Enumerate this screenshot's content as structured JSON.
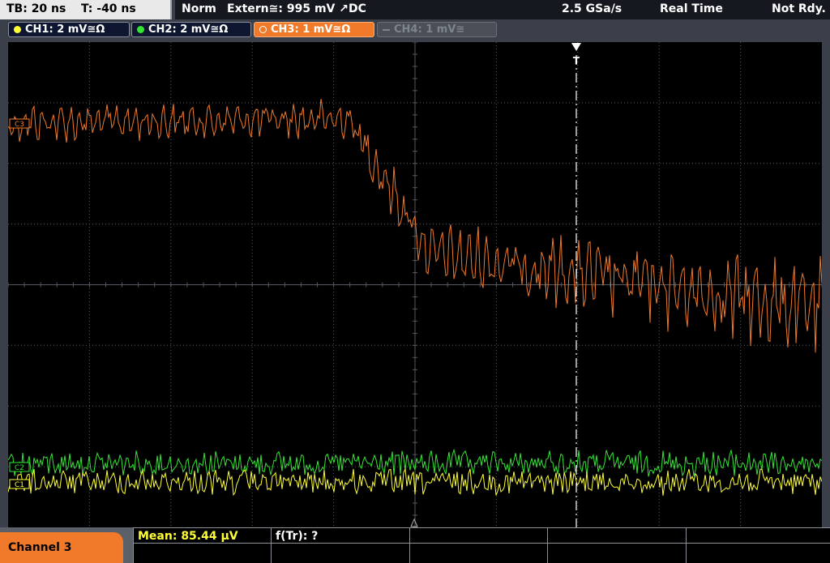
{
  "status": {
    "timebase": "TB: 20 ns",
    "trigger_time": "T: -40 ns",
    "trigger_mode": "Norm",
    "trigger_source": "Extern≅: 995 mV ↗DC",
    "sample_rate": "2.5 GSa/s",
    "acq_mode": "Real Time",
    "state": "Not Rdy."
  },
  "channels": [
    {
      "label": "CH1: 2 mV≅Ω",
      "color": "#ffff33",
      "active": false,
      "enabled": true
    },
    {
      "label": "CH2: 2 mV≅Ω",
      "color": "#33e633",
      "active": false,
      "enabled": true
    },
    {
      "label": "CH3: 1 mV≅Ω",
      "color": "#f07a2a",
      "active": true,
      "enabled": true
    },
    {
      "label": "CH4: 1 mV≅",
      "color": "#7f848c",
      "active": false,
      "enabled": false
    }
  ],
  "markers": {
    "ch3": "C3",
    "ch2": "C2",
    "ch1": "C1",
    "trigger": "T"
  },
  "bottom": {
    "channel_panel": "Channel 3",
    "mean": "Mean: 85.44 µV",
    "ftr": "f(Tr): ?"
  },
  "colors": {
    "ch1": "#ffff33",
    "ch2": "#33e633",
    "ch3": "#f07a2a",
    "grid": "#555a60",
    "trigger_line": "#ffffff"
  }
}
